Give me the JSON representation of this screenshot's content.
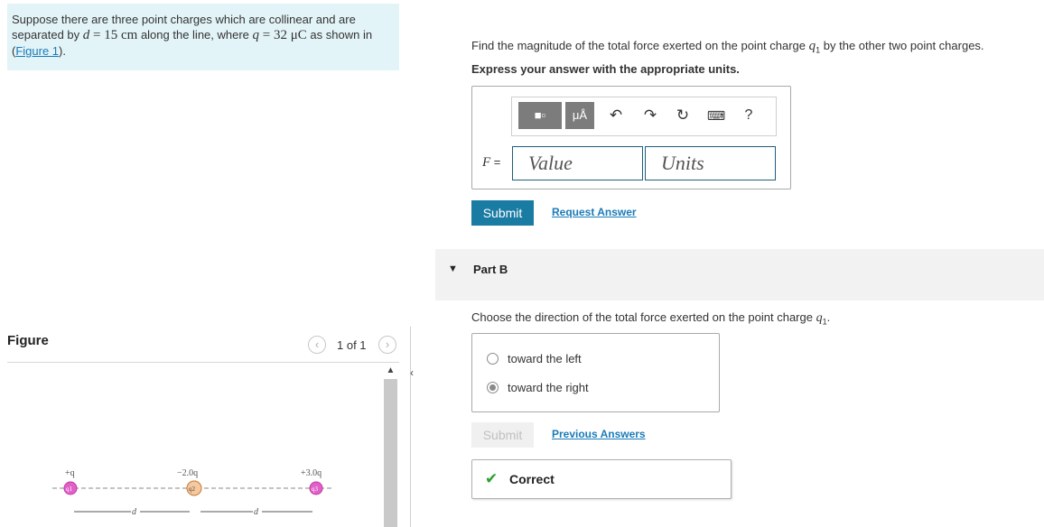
{
  "problem": {
    "text_1": "Suppose there are three point charges which are collinear and are separated by ",
    "var_d": "d",
    "eq_1": " = 15 ",
    "unit_cm": "cm",
    "text_2": " along the line, where ",
    "var_q": "q",
    "eq_2": " = 32 ",
    "unit_uc": "μC",
    "text_3": " as shown in (",
    "figure_link": "Figure 1",
    "text_4": ")."
  },
  "figure": {
    "title": "Figure",
    "pager": "1 of 1",
    "prev_icon": "chevron-left-icon",
    "next_icon": "chevron-right-icon",
    "charges": [
      {
        "top": "+q",
        "label": "q1",
        "color": "#e060c8"
      },
      {
        "top": "−2.0q",
        "label": "q2",
        "color": "#f6c8a0"
      },
      {
        "top": "+3.0q",
        "label": "q3",
        "color": "#e060c8"
      }
    ],
    "distance_label": "d"
  },
  "partA": {
    "prompt_1": "Find the magnitude of the total force exerted on the point charge ",
    "prompt_var": "q",
    "prompt_sub": "1",
    "prompt_2": " by the other two point charges.",
    "express": "Express your answer with the appropriate units.",
    "toolbar": {
      "template_icon": "template-icon",
      "units_label": "μÅ",
      "undo_icon": "undo-icon",
      "redo_icon": "redo-icon",
      "reset_icon": "reset-icon",
      "keyboard_icon": "keyboard-icon",
      "help_label": "?"
    },
    "var_label": "F",
    "equals": "=",
    "value_placeholder": "Value",
    "units_placeholder": "Units",
    "submit": "Submit",
    "request_answer": "Request Answer"
  },
  "partB": {
    "title": "Part B",
    "prompt_1": "Choose the direction of the total force exerted on the point charge ",
    "prompt_var": "q",
    "prompt_sub": "1",
    "prompt_2": ".",
    "choices": [
      {
        "label": "toward the left",
        "selected": false
      },
      {
        "label": "toward the right",
        "selected": true
      }
    ],
    "submit": "Submit",
    "previous_answers": "Previous Answers",
    "result": "Correct"
  },
  "colors": {
    "accent": "#1a7ba3",
    "problem_bg": "#e3f4f8",
    "correct": "#2f9e2f"
  }
}
